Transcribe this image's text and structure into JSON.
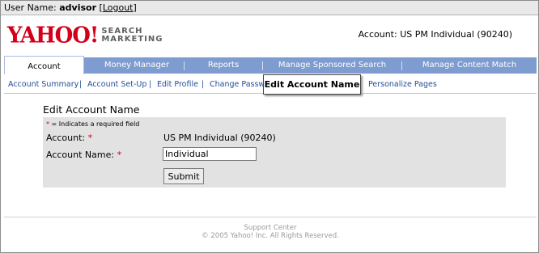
{
  "userbar": {
    "user_label": "User Name:",
    "user_name": "advisor",
    "logout_label": "Logout",
    "open_bracket": "[",
    "close_bracket": "]"
  },
  "header": {
    "logo_word": "YAHOO!",
    "logo_sub_line1": "SEARCH",
    "logo_sub_line2": "MARKETING",
    "account_label": "Account:",
    "account_value": "US PM Individual (90240)"
  },
  "tabs": [
    {
      "label": "Account",
      "active": true
    },
    {
      "label": "Money Manager",
      "active": false
    },
    {
      "label": "Reports",
      "active": false
    },
    {
      "label": "Manage Sponsored Search",
      "active": false
    },
    {
      "label": "Manage Content Match",
      "active": false
    }
  ],
  "subnav": {
    "separator": "|",
    "items": [
      {
        "label": "Account Summary"
      },
      {
        "label": "Account Set-Up"
      },
      {
        "label": "Edit Profile"
      },
      {
        "label": "Change Passw"
      },
      {
        "label": "Personalize Pages"
      }
    ]
  },
  "tooltip": {
    "text": "Edit Account Name"
  },
  "form": {
    "title": "Edit Account Name",
    "required_star": "*",
    "required_note": "= Indicates a required field",
    "account_label": "Account:",
    "account_value": "US PM Individual (90240)",
    "name_label": "Account Name:",
    "name_value": "Individual",
    "submit_label": "Submit"
  },
  "footer": {
    "support": "Support Center",
    "copyright": "© 2005 Yahoo! Inc. All Rights Reserved."
  },
  "colors": {
    "brand_red": "#d3001b",
    "tab_blue": "#7e9ccf",
    "link_blue": "#254e99",
    "form_gray": "#e2e2e2"
  }
}
